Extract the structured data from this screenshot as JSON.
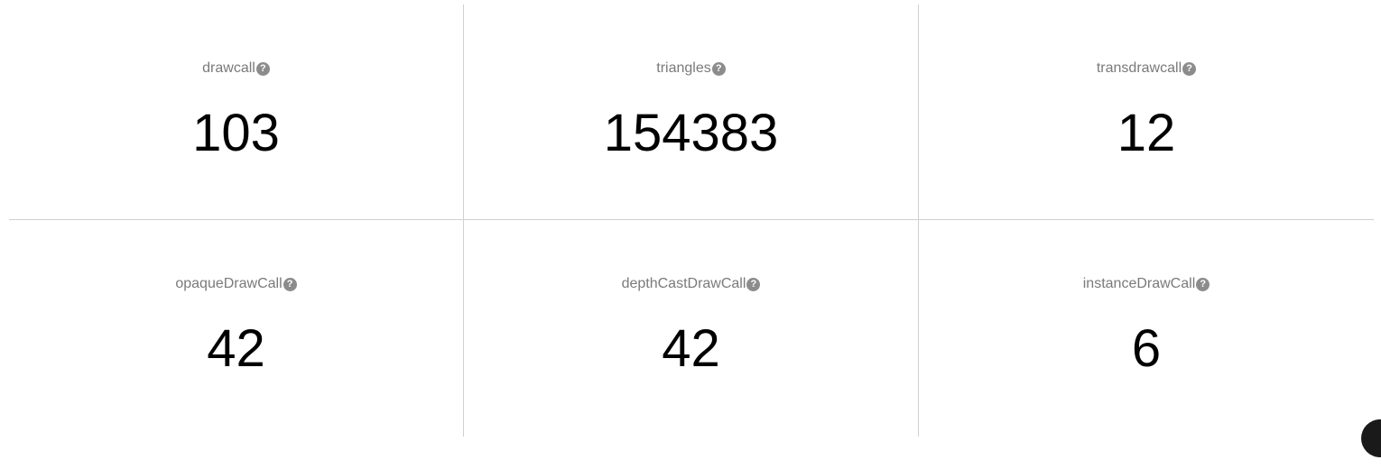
{
  "metrics": [
    {
      "label": "drawcall",
      "value": "103"
    },
    {
      "label": "triangles",
      "value": "154383"
    },
    {
      "label": "transdrawcall",
      "value": "12"
    },
    {
      "label": "opaqueDrawCall",
      "value": "42"
    },
    {
      "label": "depthCastDrawCall",
      "value": "42"
    },
    {
      "label": "instanceDrawCall",
      "value": "6"
    }
  ],
  "help_glyph": "?",
  "icons": {
    "help": "question-circle-icon"
  },
  "colors": {
    "label": "#7a7a7a",
    "value": "#000000",
    "divider": "#d0d0d0",
    "help_icon": "#8c8c8c"
  }
}
